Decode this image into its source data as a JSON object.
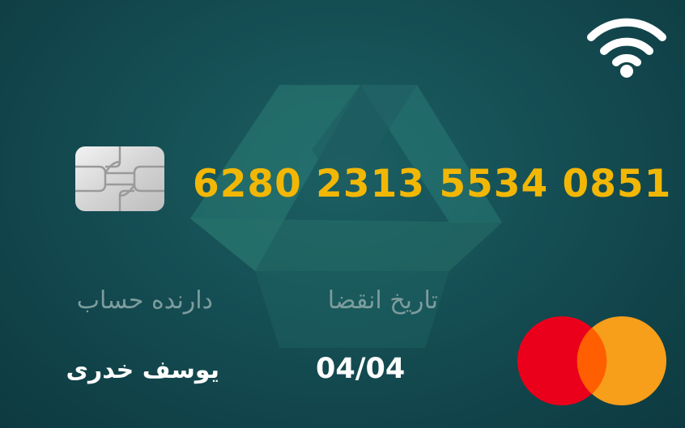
{
  "card": {
    "number": "6280 2313 5534 0851",
    "holder_label": "دارنده حساب",
    "holder_name": "یوسف خدری",
    "expiry_label": "تاریخ انقضا",
    "expiry_value": "04/04"
  },
  "icons": {
    "contactless": "wifi-icon",
    "chip": "chip-icon",
    "network_logo": "mastercard-logo",
    "bank_logo": "bank-triangle-logo"
  },
  "colors": {
    "background": "#134a50",
    "card_number": "#f2b705",
    "label": "#7d9c9e",
    "value": "#ffffff",
    "mastercard_red": "#eb001b",
    "mastercard_orange": "#f79e1b",
    "mastercard_overlap": "#ff5f00"
  }
}
